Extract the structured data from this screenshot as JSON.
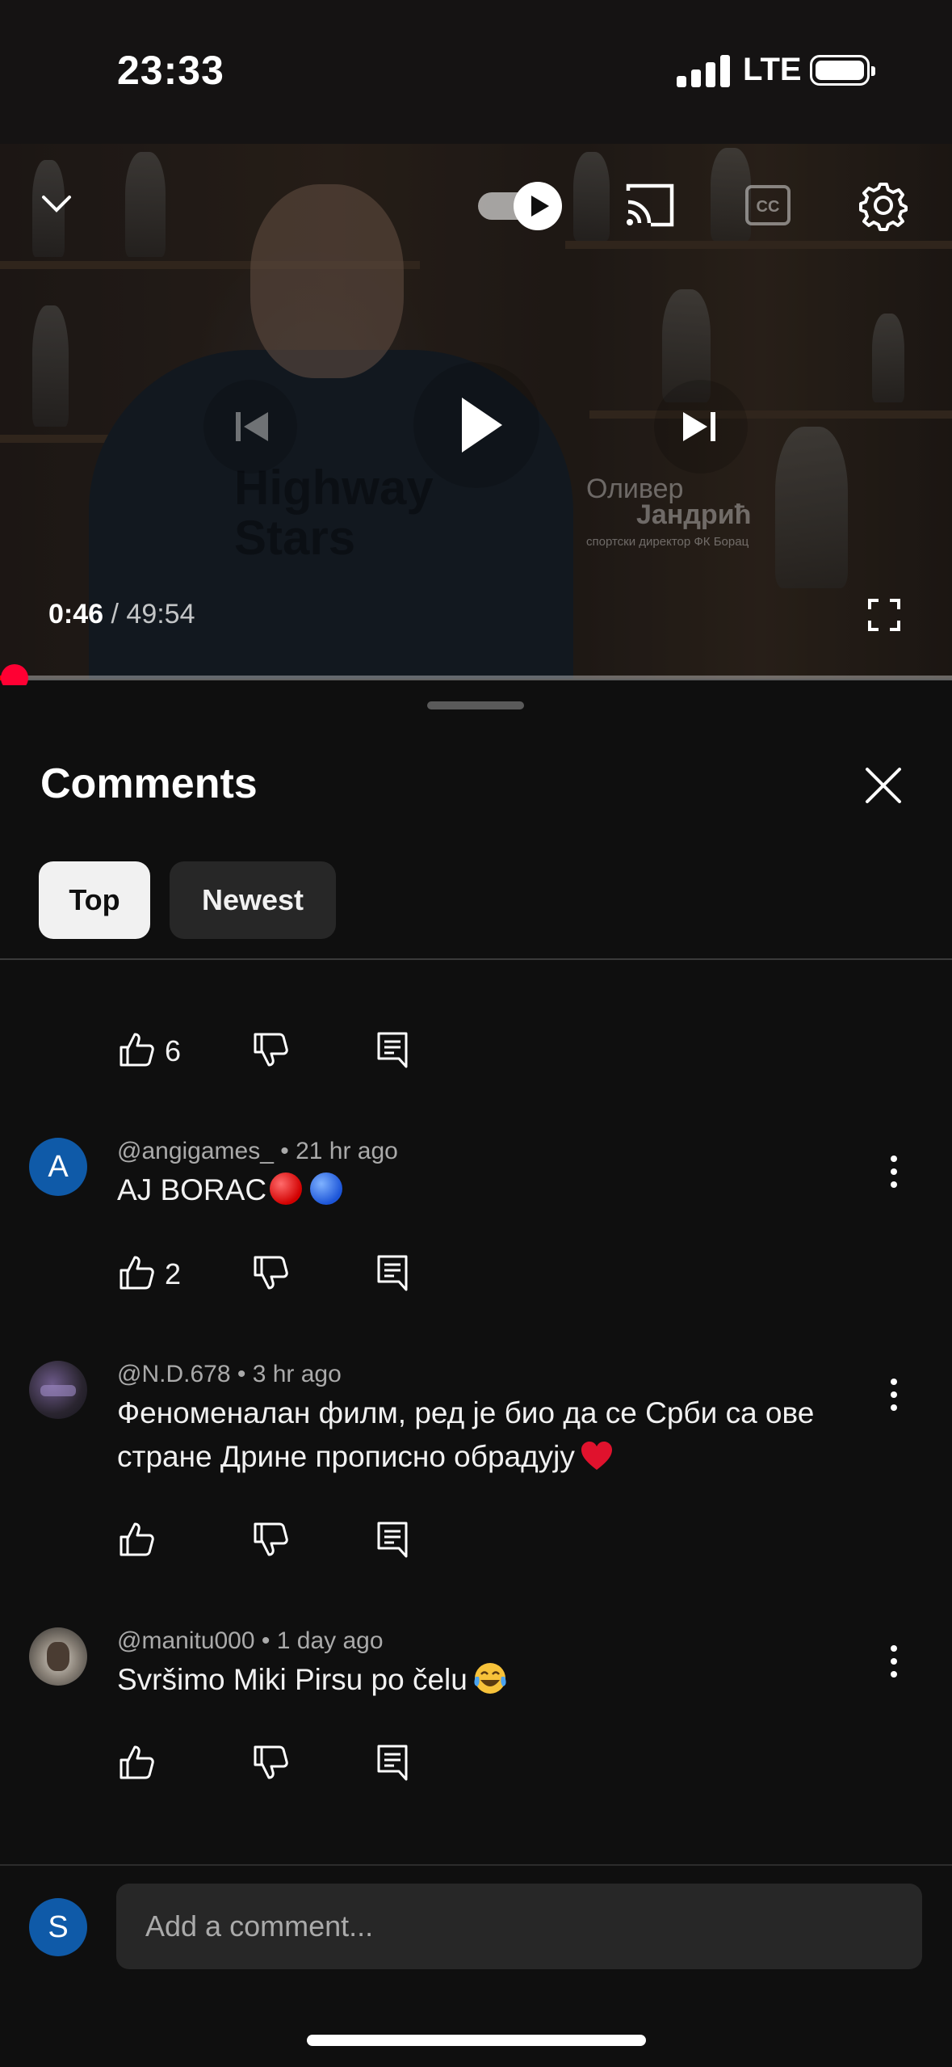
{
  "status_bar": {
    "time": "23:33",
    "network": "LTE",
    "icons": [
      "cellular-signal-icon",
      "battery-icon"
    ]
  },
  "player": {
    "current_time": "0:46",
    "duration": "/ 49:54",
    "watermark_name": "Оливер",
    "watermark_surname": "Јандрић",
    "watermark_subtitle": "спортски директор ФК Борац",
    "background_text": "Highway Stars",
    "autoplay_on": true,
    "icons": [
      "chevron-down-icon",
      "autoplay-toggle-icon",
      "cast-icon",
      "captions-icon",
      "settings-gear-icon",
      "previous-icon",
      "play-icon",
      "next-icon",
      "fullscreen-icon"
    ],
    "progress_percent": 1.5,
    "accent_color": "#ff0033"
  },
  "comments_panel": {
    "title": "Comments",
    "tabs": [
      {
        "label": "Top",
        "selected": true
      },
      {
        "label": "Newest",
        "selected": false
      }
    ],
    "partial_row": {
      "like_count": "6"
    },
    "comments": [
      {
        "author": "@angigames_",
        "time": "• 21 hr ago",
        "text": "AJ BORAC",
        "emoji": [
          "red-circle",
          "blue-circle"
        ],
        "like_count": "2",
        "avatar_letter": "A",
        "avatar_color": "#0f5aa8"
      },
      {
        "author": "@N.D.678",
        "time": "• 3 hr ago",
        "text_line1": "Феноменалан филм, ред је био да се Срби са ове",
        "text_line2": "стране Дрине прописно обрадују",
        "emoji": [
          "red-heart"
        ],
        "like_count": ""
      },
      {
        "author": "@manitu000",
        "time": "• 1 day ago",
        "text": "Svršimo Miki Pirsu po čelu",
        "emoji": [
          "tears-of-joy"
        ],
        "like_count": ""
      }
    ]
  },
  "composer": {
    "avatar_letter": "S",
    "avatar_color": "#0f5aa8",
    "placeholder": "Add a comment..."
  }
}
